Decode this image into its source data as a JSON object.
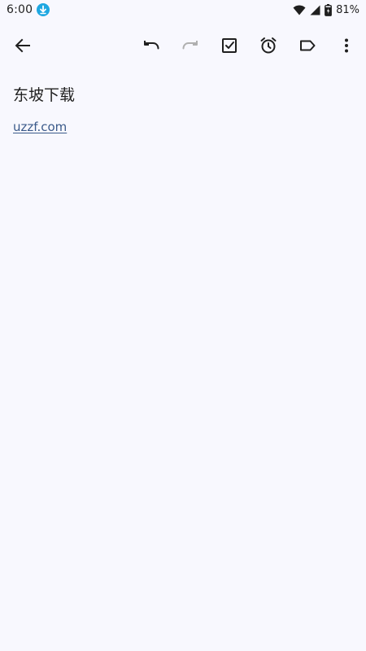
{
  "status_bar": {
    "time": "6:00",
    "battery_percent": "81%",
    "icons": [
      "download-notification-icon",
      "wifi-icon",
      "cell-signal-icon",
      "battery-charging-icon"
    ]
  },
  "toolbar": {
    "icons": [
      "back-arrow-icon",
      "undo-icon",
      "redo-icon",
      "checkbox-icon",
      "reminder-alarm-icon",
      "label-icon",
      "more-vert-icon"
    ],
    "redo_enabled": false
  },
  "note": {
    "title": "东坡下载",
    "link_text": "uzzf.com"
  },
  "colors": {
    "background": "#F8F8FE",
    "text": "#1f1f1f",
    "link": "#3b5a8a",
    "disabled_icon": "#b0b0b0",
    "download_badge": "#1ea7e1"
  }
}
